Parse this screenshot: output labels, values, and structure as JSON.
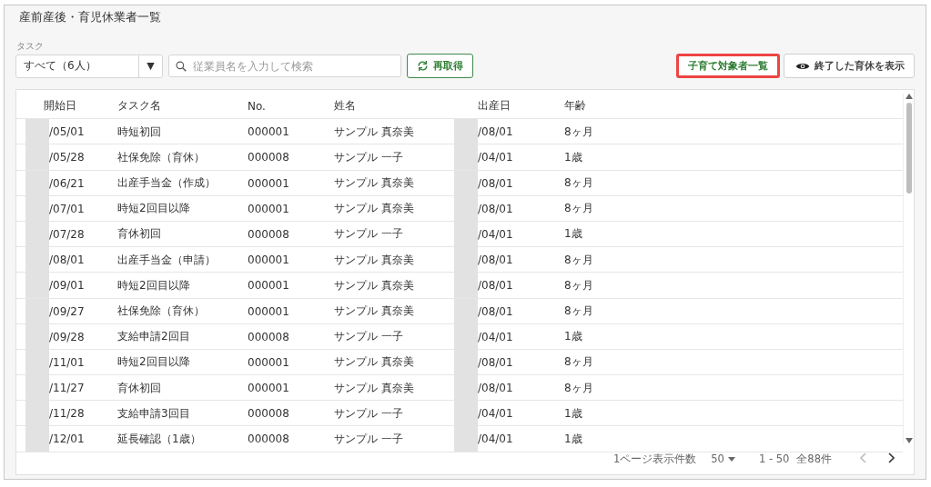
{
  "title": "産前産後・育児休業者一覧",
  "filter": {
    "label": "タスク",
    "value": "すべて（6人）",
    "caret": "▼"
  },
  "search": {
    "placeholder": "従業員名を入力して検索"
  },
  "refresh_button": {
    "label": "再取得"
  },
  "childcare_button": {
    "label": "子育て対象者一覧",
    "highlighted": true
  },
  "show_ended_button": {
    "label": "終了した育休を表示"
  },
  "table": {
    "columns": [
      "開始日",
      "タスク名",
      "No.",
      "姓名",
      "出産日",
      "年齢"
    ],
    "rows": [
      [
        "/05/01",
        "時短初回",
        "000001",
        "サンプル 真奈美",
        "/08/01",
        "8ヶ月"
      ],
      [
        "/05/28",
        "社保免除（育休）",
        "000008",
        "サンプル 一子",
        "/04/01",
        "1歳"
      ],
      [
        "/06/21",
        "出産手当金（作成）",
        "000001",
        "サンプル 真奈美",
        "/08/01",
        "8ヶ月"
      ],
      [
        "/07/01",
        "時短2回目以降",
        "000001",
        "サンプル 真奈美",
        "/08/01",
        "8ヶ月"
      ],
      [
        "/07/28",
        "育休初回",
        "000008",
        "サンプル 一子",
        "/04/01",
        "1歳"
      ],
      [
        "/08/01",
        "出産手当金（申請）",
        "000001",
        "サンプル 真奈美",
        "/08/01",
        "8ヶ月"
      ],
      [
        "/09/01",
        "時短2回目以降",
        "000001",
        "サンプル 真奈美",
        "/08/01",
        "8ヶ月"
      ],
      [
        "/09/27",
        "社保免除（育休）",
        "000001",
        "サンプル 真奈美",
        "/08/01",
        "8ヶ月"
      ],
      [
        "/09/28",
        "支給申請2回目",
        "000008",
        "サンプル 一子",
        "/04/01",
        "1歳"
      ],
      [
        "/11/01",
        "時短2回目以降",
        "000001",
        "サンプル 真奈美",
        "/08/01",
        "8ヶ月"
      ],
      [
        "/11/27",
        "育休初回",
        "000001",
        "サンプル 真奈美",
        "/08/01",
        "8ヶ月"
      ],
      [
        "/11/28",
        "支給申請3回目",
        "000008",
        "サンプル 一子",
        "/04/01",
        "1歳"
      ],
      [
        "/12/01",
        "延長確認（1歳）",
        "000008",
        "サンプル 一子",
        "/04/01",
        "1歳"
      ]
    ]
  },
  "pagination": {
    "per_page_label": "1ページ表示件数",
    "per_page": "50",
    "range": "1 - 50",
    "total": "全88件",
    "prev_disabled": true,
    "next_disabled": false
  }
}
